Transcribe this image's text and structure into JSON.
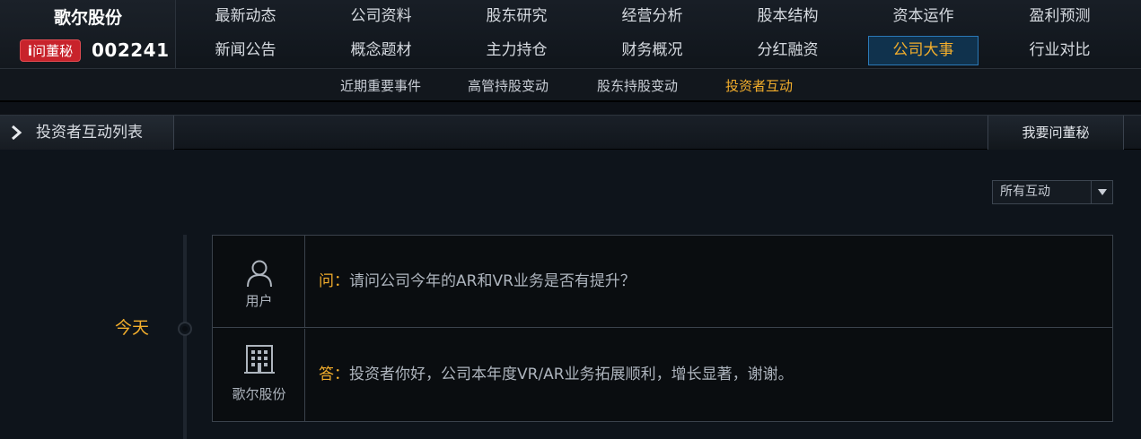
{
  "brand": {
    "name": "歌尔股份",
    "badge": "问董秘",
    "badge_mark": "i",
    "code": "002241"
  },
  "menu": {
    "row1": [
      "最新动态",
      "公司资料",
      "股东研究",
      "经营分析",
      "股本结构",
      "资本运作",
      "盈利预测"
    ],
    "row2": [
      "新闻公告",
      "概念题材",
      "主力持仓",
      "财务概况",
      "分红融资",
      "公司大事",
      "行业对比"
    ],
    "active": "公司大事"
  },
  "submenu": {
    "items": [
      "近期重要事件",
      "高管持股变动",
      "股东持股变动",
      "投资者互动"
    ],
    "active": "投资者互动"
  },
  "section": {
    "title": "投资者互动列表",
    "ask_button": "我要问董秘"
  },
  "filter": {
    "selected": "所有互动"
  },
  "timeline": {
    "date": "今天"
  },
  "qa": {
    "question": {
      "user_label": "用户",
      "prefix": "问：",
      "text": "请问公司今年的AR和VR业务是否有提升？"
    },
    "answer": {
      "user_label": "歌尔股份",
      "prefix": "答：",
      "text": "投资者你好，公司本年度VR/AR业务拓展顺利，增长显著，谢谢。"
    }
  },
  "colors": {
    "accent": "#f3ae2c",
    "badge": "#c8232b",
    "active_tab_bg": "#10324d",
    "background": "#0e141b"
  },
  "icons": {
    "user": "user-icon",
    "company": "building-icon",
    "section": "chevron-right-icon",
    "dropdown": "triangle-down-icon"
  }
}
